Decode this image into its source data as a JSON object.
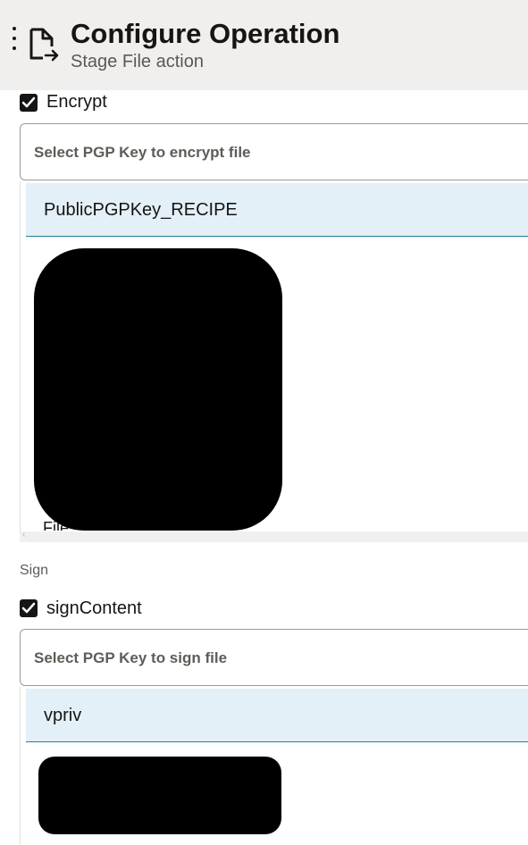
{
  "header": {
    "title": "Configure Operation",
    "subtitle": "Stage File action",
    "menu_icon": "kebab-menu-icon",
    "doc_icon": "document-export-icon"
  },
  "encrypt": {
    "checkbox_label": "Encrypt",
    "checked": true,
    "select_placeholder": "Select PGP Key to encrypt file",
    "selected_item": "PublicPGPKey_RECIPE",
    "partial_item": "File"
  },
  "sign": {
    "section_label": "Sign",
    "checkbox_label": "signContent",
    "checked": true,
    "select_placeholder": "Select PGP Key to sign file",
    "selected_item": "vpriv"
  },
  "colors": {
    "header_bg": "#f1efed",
    "selected_row_bg": "#e4f0f7",
    "selected_row_border": "#227e9e",
    "checkbox_fill": "#161513"
  }
}
